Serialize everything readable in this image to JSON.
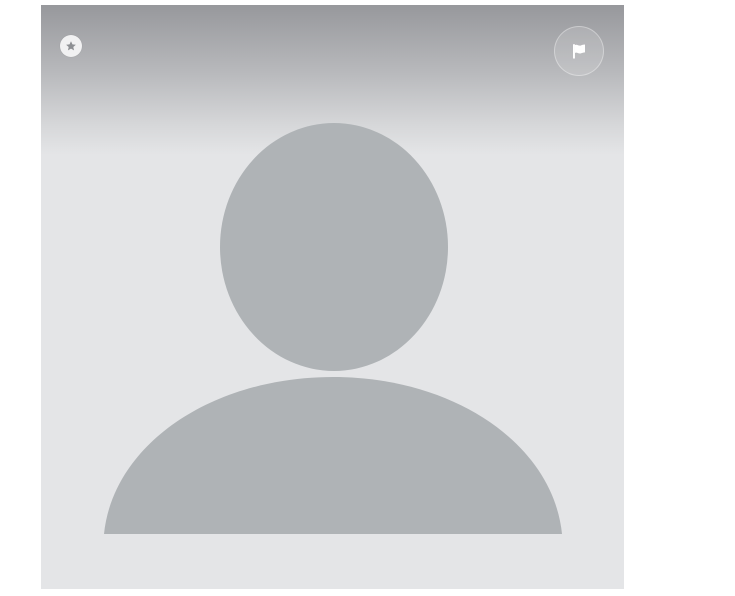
{
  "profile_photo": {
    "placeholder": true,
    "icons": {
      "favorite": "star-icon",
      "report": "flag-icon",
      "avatar": "person-placeholder-icon"
    },
    "colors": {
      "background": "#e4e5e7",
      "silhouette": "#afb3b6",
      "gradient_top": "#97989c",
      "badge_icon": "#8d8f93",
      "flag_icon": "#ffffff"
    }
  }
}
